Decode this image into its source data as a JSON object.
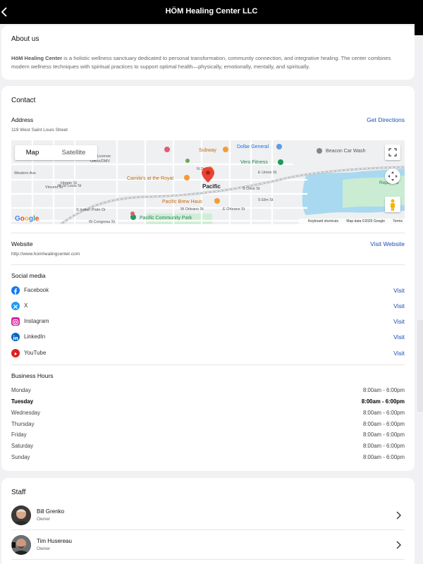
{
  "header": {
    "title": "HÖM Healing Center LLC"
  },
  "about": {
    "heading": "About us",
    "lead": "HöM Healing Center",
    "text": " is a holistic wellness sanctuary dedicated to personal transformation, community connection, and integrative healing. The center combines modern wellness techniques with spiritual practices to support optimal health—physically, emotionally, mentally, and spiritually."
  },
  "contact": {
    "heading": "Contact",
    "address_label": "Address",
    "address": "119 West Saint Louis Street",
    "directions_link": "Get Directions",
    "map": {
      "toggle_map": "Map",
      "toggle_satellite": "Satellite",
      "city_label": "Pacific",
      "poi": [
        "Subway",
        "Dollar General",
        "Beacon Car Wash",
        "Vero Fitness",
        "Camila's at the Royal",
        "Pacific Brew Haus",
        "Pacific Community Park",
        "License Office/DMV",
        "Reptiland"
      ],
      "streets": [
        "W Congress St",
        "W Orleans St",
        "E Orleans St",
        "E Union St",
        "S Indian Pride Dr",
        "W St Louis St",
        "Vincent St",
        "Hogan St",
        "Western Ave",
        "W Payne St",
        "N 2nd St",
        "S Olive St",
        "S Elm St"
      ],
      "google_logo": "Google",
      "footer": [
        "Keyboard shortcuts",
        "Map data ©2025 Google",
        "Terms"
      ]
    },
    "website_label": "Website",
    "website_url": "http://www.homhealingcenter.com",
    "website_link": "Visit Website",
    "social_heading": "Social media",
    "social": [
      {
        "name": "Facebook",
        "action": "Visit",
        "color": "#1877f2"
      },
      {
        "name": "X",
        "action": "Visit",
        "color": "#1d9bf0"
      },
      {
        "name": "Instagram",
        "action": "Visit",
        "color": "#d6249f"
      },
      {
        "name": "LinkedIn",
        "action": "Visit",
        "color": "#0a66c2"
      },
      {
        "name": "YouTube",
        "action": "Visit",
        "color": "#e02020"
      }
    ],
    "hours_heading": "Business Hours",
    "hours": [
      {
        "day": "Monday",
        "time": "8:00am - 6:00pm",
        "current": false
      },
      {
        "day": "Tuesday",
        "time": "8:00am - 6:00pm",
        "current": true
      },
      {
        "day": "Wednesday",
        "time": "8:00am - 6:00pm",
        "current": false
      },
      {
        "day": "Thursday",
        "time": "8:00am - 6:00pm",
        "current": false
      },
      {
        "day": "Friday",
        "time": "8:00am - 6:00pm",
        "current": false
      },
      {
        "day": "Saturday",
        "time": "8:00am - 6:00pm",
        "current": false
      },
      {
        "day": "Sunday",
        "time": "8:00am - 6:00pm",
        "current": false
      }
    ]
  },
  "staff": {
    "heading": "Staff",
    "members": [
      {
        "name": "Bill Grenko",
        "role": "Owner"
      },
      {
        "name": "Tim Husereau",
        "role": "Owner"
      }
    ]
  },
  "colors": {
    "link": "#1a4fb5",
    "header_bg": "#000000",
    "pin": "#ea4335"
  }
}
